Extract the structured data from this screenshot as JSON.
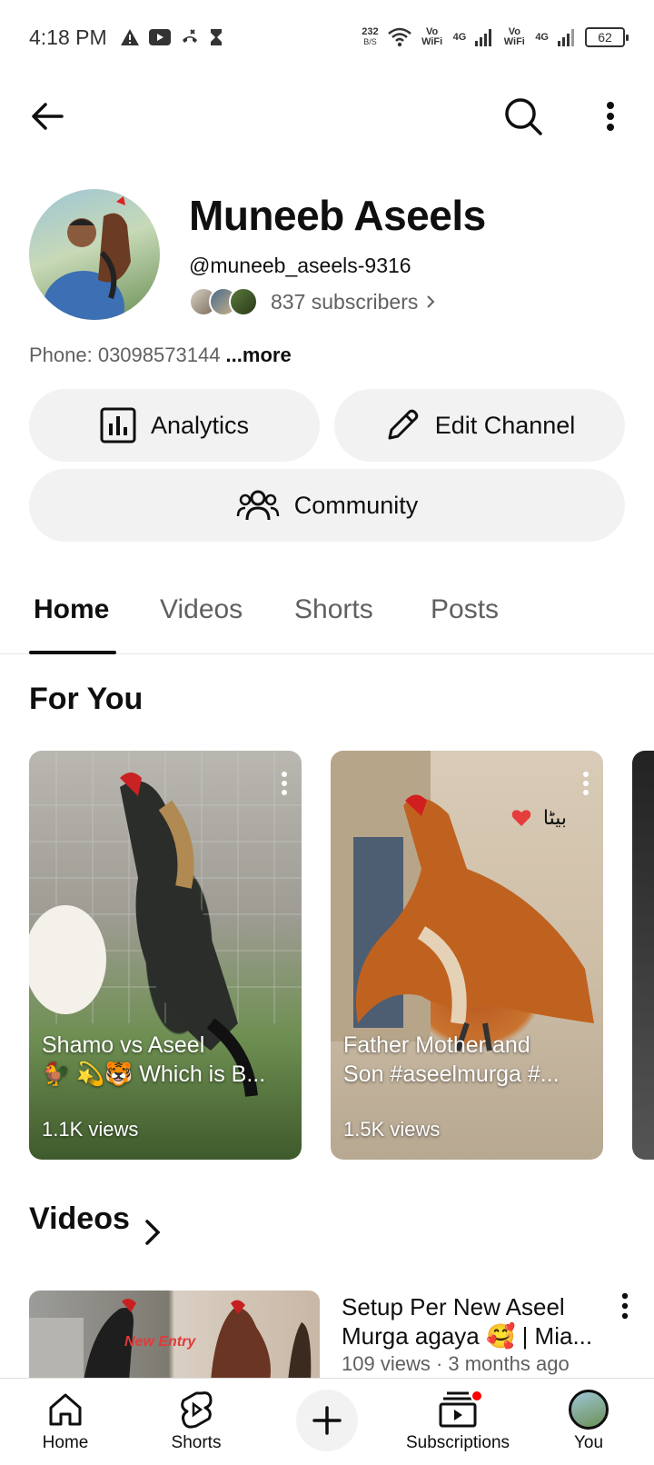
{
  "status_bar": {
    "time": "4:18 PM",
    "net_speed": "232",
    "net_unit": "B/S",
    "sim1_label": "Vo WiFi",
    "sim1_net": "4G",
    "sim2_label": "Vo WiFi",
    "sim2_net": "4G",
    "battery": "62"
  },
  "channel": {
    "name": "Muneeb Aseels",
    "handle": "@muneeb_aseels-9316",
    "subscribers": "837 subscribers",
    "phone_prefix": "Phone: 03098573144 ",
    "more_label": "...more"
  },
  "actions": {
    "analytics": "Analytics",
    "edit_channel": "Edit Channel",
    "community": "Community"
  },
  "tabs": [
    {
      "label": "Home",
      "active": true
    },
    {
      "label": "Videos",
      "active": false
    },
    {
      "label": "Shorts",
      "active": false
    },
    {
      "label": "Posts",
      "active": false
    }
  ],
  "for_you": {
    "title": "For You",
    "shorts": [
      {
        "title_line1": "Shamo vs Aseel",
        "title_line2": "🐓 💫🐯 Which is B...",
        "views": "1.1K views"
      },
      {
        "title_line1": "Father Mother and",
        "title_line2": "Son #aseelmurga #...",
        "views": "1.5K views"
      }
    ],
    "watermark_text": "بیٹا"
  },
  "videos_section": {
    "title": "Videos",
    "items": [
      {
        "title_line1": "Setup Per New Aseel",
        "title_line2": "Murga agaya 🥰 | Mia...",
        "meta": "109 views · 3 months ago",
        "thumb_text": "New Entry"
      }
    ]
  },
  "bottom_nav": {
    "home": "Home",
    "shorts": "Shorts",
    "subscriptions": "Subscriptions",
    "you": "You"
  },
  "colors": {
    "accent_red": "#ff0000",
    "text_primary": "#0f0f0f",
    "text_secondary": "#606060",
    "pill_bg": "#f2f2f2"
  }
}
